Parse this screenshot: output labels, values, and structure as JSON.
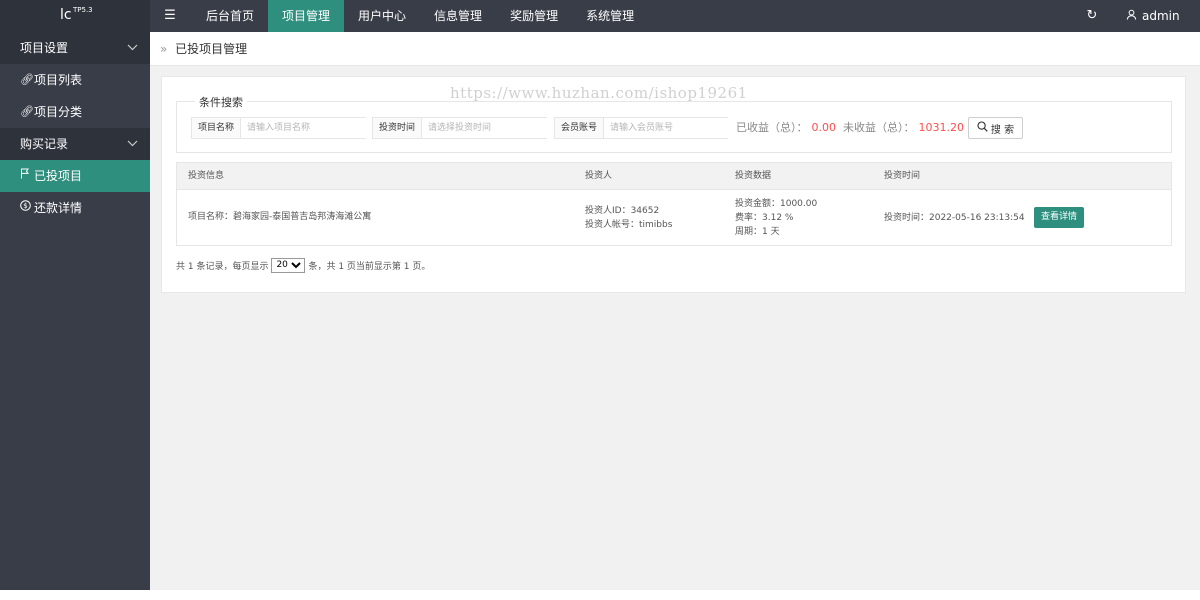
{
  "brand": {
    "name": "lc",
    "version": "TP5.3"
  },
  "topnav": {
    "menu_icon": "hamburger-icon",
    "items": [
      {
        "label": "后台首页",
        "active": false
      },
      {
        "label": "项目管理",
        "active": true
      },
      {
        "label": "用户中心",
        "active": false
      },
      {
        "label": "信息管理",
        "active": false
      },
      {
        "label": "奖励管理",
        "active": false
      },
      {
        "label": "系统管理",
        "active": false
      }
    ],
    "refresh_icon": "refresh-icon",
    "user": "admin"
  },
  "sidebar": {
    "groups": [
      {
        "label": "项目设置",
        "items": [
          {
            "label": "项目列表",
            "icon": "link-icon",
            "active": false
          },
          {
            "label": "项目分类",
            "icon": "link-icon",
            "active": false
          }
        ]
      },
      {
        "label": "购买记录",
        "items": [
          {
            "label": "已投项目",
            "icon": "flag-icon",
            "active": true
          },
          {
            "label": "还款详情",
            "icon": "dollar-icon",
            "active": false
          }
        ]
      }
    ]
  },
  "breadcrumb": {
    "title": "已投项目管理"
  },
  "watermark": "https://www.huzhan.com/ishop19261",
  "search": {
    "legend": "条件搜索",
    "fields": [
      {
        "label": "项目名称",
        "placeholder": "请输入项目名称"
      },
      {
        "label": "投资时间",
        "placeholder": "请选择投资时间"
      },
      {
        "label": "会员账号",
        "placeholder": "请输入会员账号"
      }
    ],
    "earned_label": "已收益（总）：",
    "earned_value": "0.00",
    "unearned_label": "未收益（总）：",
    "unearned_value": "1031.20",
    "button": "搜 索"
  },
  "table": {
    "headers": [
      "投资信息",
      "投资人",
      "投资数据",
      "投资时间"
    ],
    "rows": [
      {
        "project": "项目名称：碧海家园-泰国普吉岛邦涛海滩公寓",
        "investor_id": "投资人ID：34652",
        "investor_account": "投资人帐号：timibbs",
        "amount": "投资金额：1000.00",
        "rate": "费率：3.12 %",
        "period": "周期：1 天",
        "time": "投资时间：2022-05-16 23:13:54",
        "action": "查看详情"
      }
    ]
  },
  "pager": {
    "prefix": "共 1 条记录，每页显示",
    "page_size": "20",
    "suffix": "条，共 1 页当前显示第 1 页。"
  }
}
